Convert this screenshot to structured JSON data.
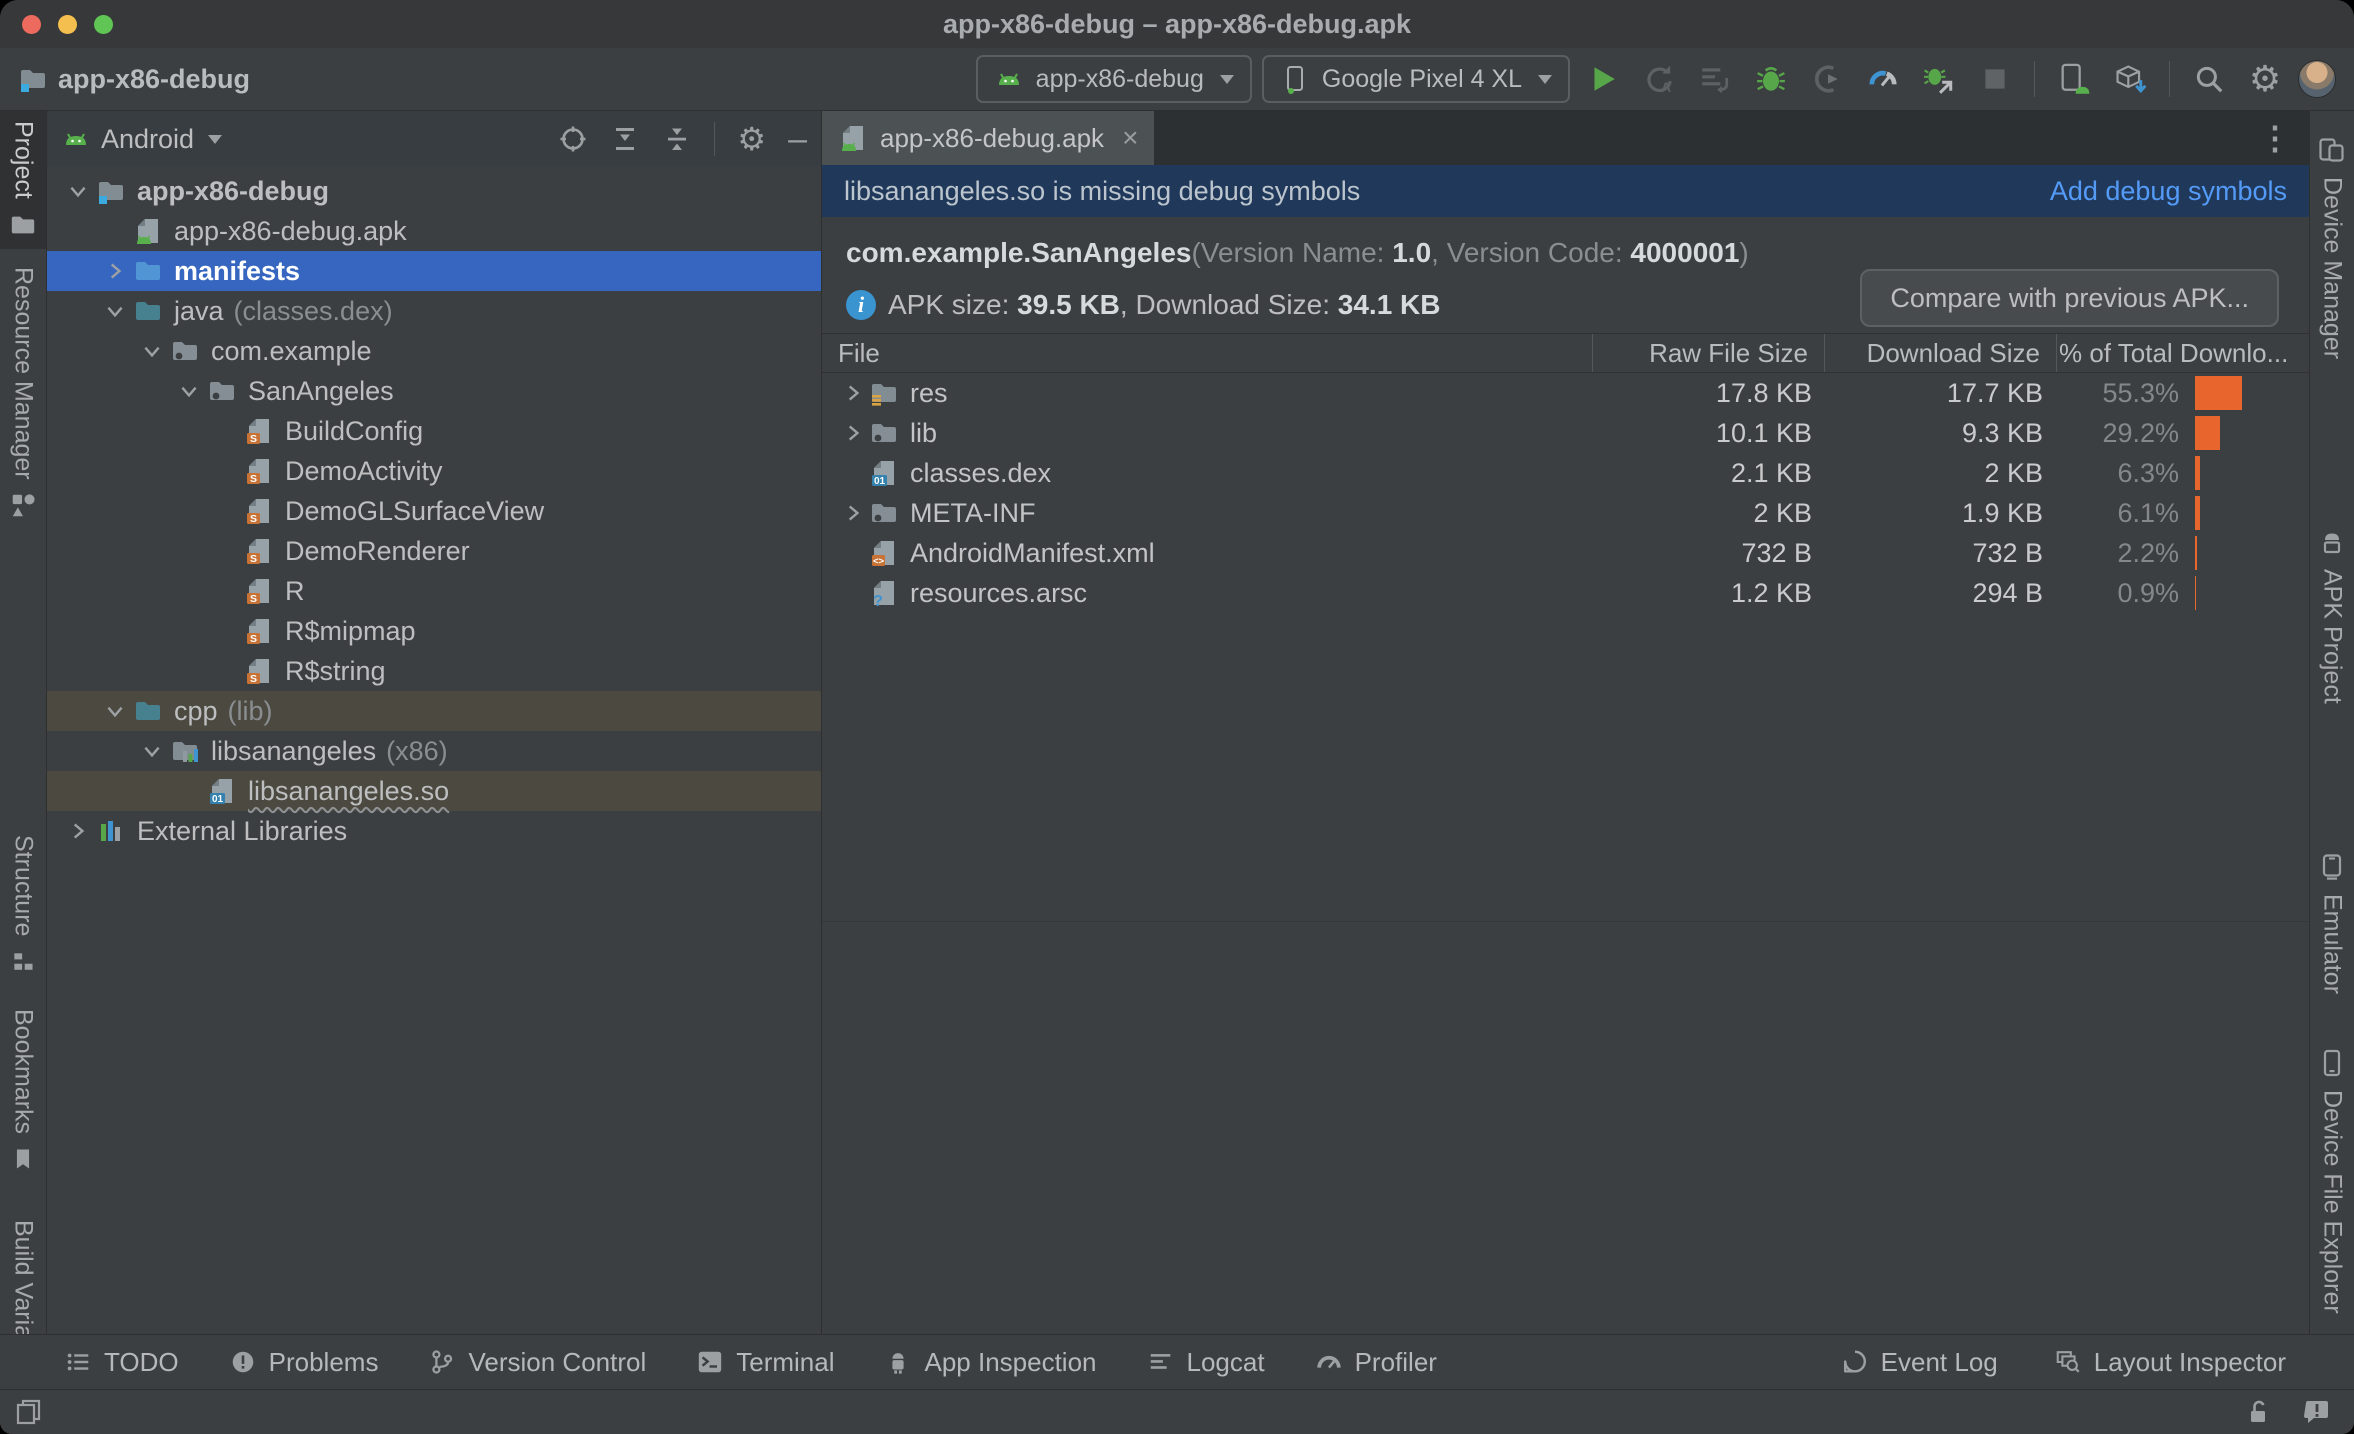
{
  "colors": {
    "selection_blue": "#3666c0",
    "banner_navy": "#20395a",
    "link_blue": "#549af7",
    "bar_orange": "#e8652d",
    "run_green": "#57a64a"
  },
  "window": {
    "title": "app-x86-debug – app-x86-debug.apk"
  },
  "toolbar": {
    "project_name": "app-x86-debug",
    "run_config": "app-x86-debug",
    "device": "Google Pixel 4 XL"
  },
  "left_stripe": [
    {
      "label": "Project",
      "icon": "sb-folder",
      "active": true,
      "gap": 0
    },
    {
      "label": "Resource Manager",
      "icon": "sb-resource",
      "gap": 8
    },
    {
      "label": "Structure",
      "icon": "sb-structure",
      "gap": 296
    },
    {
      "label": "Bookmarks",
      "icon": "sb-bookmarks",
      "gap": 14
    },
    {
      "label": "Build Variants",
      "icon": "sb-android",
      "gap": 28
    }
  ],
  "right_stripe": [
    {
      "label": "Device Manager",
      "icon": "sb-device-manager",
      "gap": 14
    },
    {
      "label": "APK Project",
      "icon": "sb-apk",
      "gap": 148
    },
    {
      "label": "Emulator",
      "icon": "sb-emulator",
      "gap": 128
    },
    {
      "label": "Device File Explorer",
      "icon": "sb-dfe",
      "gap": 34
    }
  ],
  "project_panel": {
    "view": "Android",
    "tree": [
      {
        "level": 0,
        "chevron": "down",
        "icon": "module-folder",
        "label": "app-x86-debug",
        "bold": true
      },
      {
        "level": 1,
        "chevron": null,
        "icon": "apk-file",
        "label": "app-x86-debug.apk"
      },
      {
        "level": 1,
        "chevron": "right",
        "icon": "folder-blue",
        "label": "manifests",
        "bold": true,
        "state": "selected"
      },
      {
        "level": 1,
        "chevron": "down",
        "icon": "folder-teal",
        "label": "java",
        "suffix": "(classes.dex)"
      },
      {
        "level": 2,
        "chevron": "down",
        "icon": "package",
        "label": "com.example"
      },
      {
        "level": 3,
        "chevron": "down",
        "icon": "package",
        "label": "SanAngeles"
      },
      {
        "level": 4,
        "chevron": null,
        "icon": "class-s",
        "label": "BuildConfig"
      },
      {
        "level": 4,
        "chevron": null,
        "icon": "class-s",
        "label": "DemoActivity"
      },
      {
        "level": 4,
        "chevron": null,
        "icon": "class-s",
        "label": "DemoGLSurfaceView"
      },
      {
        "level": 4,
        "chevron": null,
        "icon": "class-s",
        "label": "DemoRenderer"
      },
      {
        "level": 4,
        "chevron": null,
        "icon": "class-s",
        "label": "R"
      },
      {
        "level": 4,
        "chevron": null,
        "icon": "class-s",
        "label": "R$mipmap"
      },
      {
        "level": 4,
        "chevron": null,
        "icon": "class-s",
        "label": "R$string"
      },
      {
        "level": 1,
        "chevron": "down",
        "icon": "folder-teal",
        "label": "cpp",
        "suffix": "(lib)",
        "state": "olive"
      },
      {
        "level": 2,
        "chevron": "down",
        "icon": "nativelib",
        "label": "libsanangeles",
        "suffix": "(x86)"
      },
      {
        "level": 3,
        "chevron": null,
        "icon": "so-file",
        "label": "libsanangeles.so",
        "state": "olive",
        "squiggle": true
      },
      {
        "level": 0,
        "chevron": "right",
        "icon": "external-lib",
        "label": "External Libraries"
      }
    ]
  },
  "editor": {
    "tab": "app-x86-debug.apk",
    "banner": {
      "message": "libsanangeles.so is missing debug symbols",
      "action": "Add debug symbols"
    },
    "apk_info": {
      "package": "com.example.SanAngeles",
      "meta_prefix": "(Version Name: ",
      "version_name": "1.0",
      "meta_mid": ", Version Code: ",
      "version_code": "4000001",
      "meta_suffix": ")"
    },
    "size_line": {
      "prefix": "APK size: ",
      "apk_size": "39.5 KB",
      "mid": ", Download Size: ",
      "download_size": "34.1 KB"
    },
    "compare_button": "Compare with previous APK...",
    "table": {
      "columns": [
        "File",
        "Raw File Size",
        "Download Size",
        "% of Total Downlo..."
      ],
      "rows": [
        {
          "icon": "folder-res",
          "chevron": true,
          "name": "res",
          "raw": "17.8 KB",
          "download": "17.7 KB",
          "pct": "55.3%",
          "pct_val": 55.3
        },
        {
          "icon": "package",
          "chevron": true,
          "name": "lib",
          "raw": "10.1 KB",
          "download": "9.3 KB",
          "pct": "29.2%",
          "pct_val": 29.2
        },
        {
          "icon": "so-file",
          "chevron": false,
          "name": "classes.dex",
          "raw": "2.1 KB",
          "download": "2 KB",
          "pct": "6.3%",
          "pct_val": 6.3
        },
        {
          "icon": "package",
          "chevron": true,
          "name": "META-INF",
          "raw": "2 KB",
          "download": "1.9 KB",
          "pct": "6.1%",
          "pct_val": 6.1
        },
        {
          "icon": "xml-file",
          "chevron": false,
          "name": "AndroidManifest.xml",
          "raw": "732 B",
          "download": "732 B",
          "pct": "2.2%",
          "pct_val": 2.2
        },
        {
          "icon": "arsc-file",
          "chevron": false,
          "name": "resources.arsc",
          "raw": "1.2 KB",
          "download": "294 B",
          "pct": "0.9%",
          "pct_val": 0.9
        }
      ]
    }
  },
  "bottom_bar": {
    "left": [
      {
        "label": "TODO",
        "icon": "bb-todo"
      },
      {
        "label": "Problems",
        "icon": "bb-problems"
      },
      {
        "label": "Version Control",
        "icon": "bb-vcs"
      },
      {
        "label": "Terminal",
        "icon": "bb-terminal"
      },
      {
        "label": "App Inspection",
        "icon": "bb-inspect"
      },
      {
        "label": "Logcat",
        "icon": "bb-logcat"
      },
      {
        "label": "Profiler",
        "icon": "bb-profiler"
      }
    ],
    "right": [
      {
        "label": "Event Log",
        "icon": "bb-eventlog"
      },
      {
        "label": "Layout Inspector",
        "icon": "bb-layout"
      }
    ]
  }
}
